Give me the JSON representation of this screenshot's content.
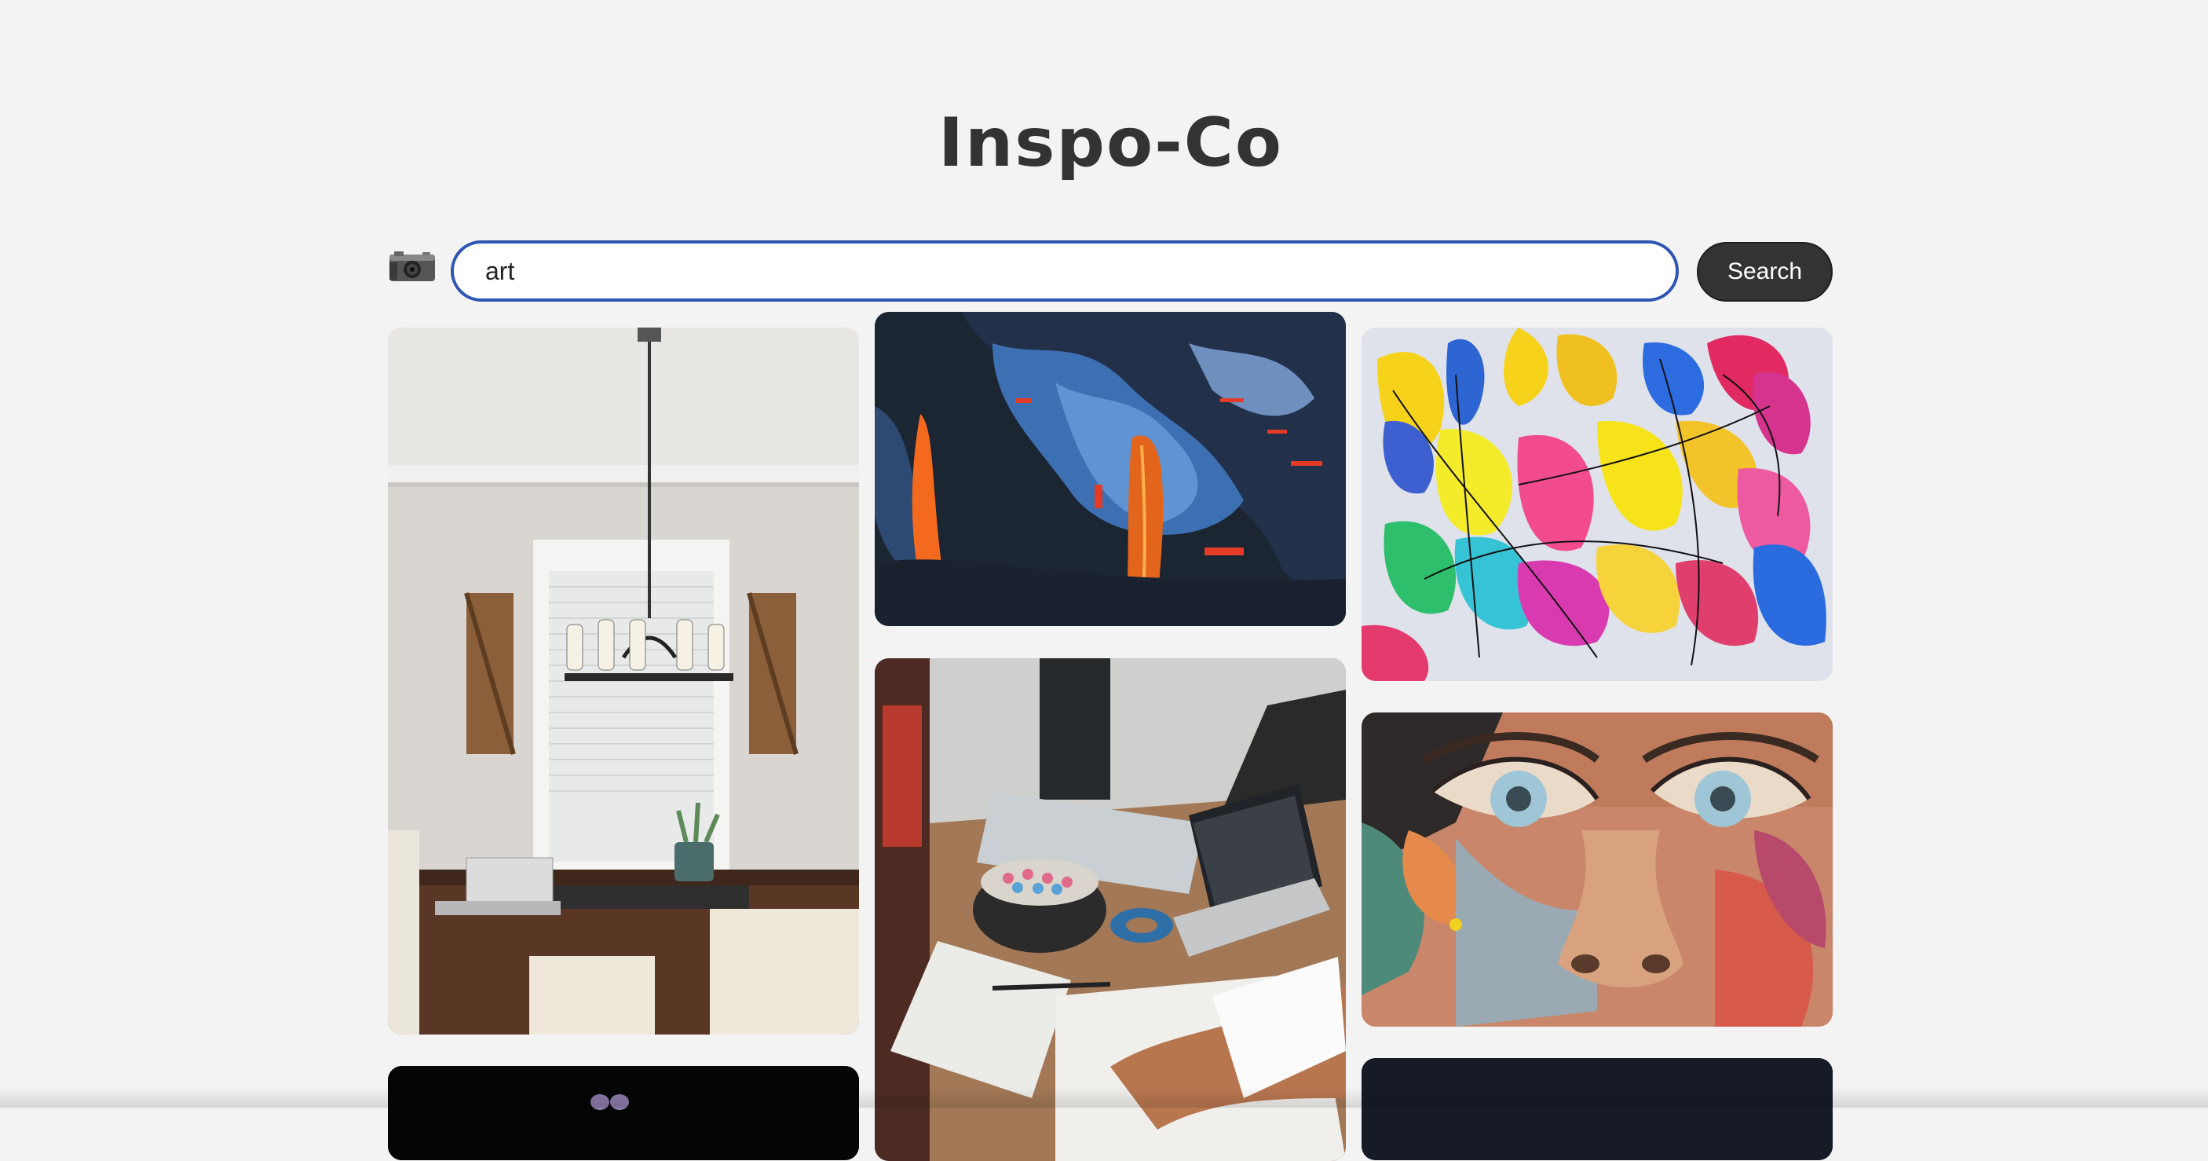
{
  "app": {
    "title": "Inspo-Co"
  },
  "search": {
    "value": "art",
    "button_label": "Search",
    "camera_icon": "camera-icon"
  },
  "gallery": {
    "images": [
      {
        "subject": "dining-room-interior"
      },
      {
        "subject": "abstract-blue-orange-painting"
      },
      {
        "subject": "colorful-splash-painting"
      },
      {
        "subject": "workspace-desk-art-supplies"
      },
      {
        "subject": "street-art-face-mural"
      },
      {
        "subject": "dark-photo-partial"
      },
      {
        "subject": "dark-photo-partial"
      }
    ]
  },
  "colors": {
    "background": "#f3f3f3",
    "title": "#333333",
    "input_border": "#2f56b4",
    "button_bg": "#333333",
    "button_text": "#ffffff"
  }
}
